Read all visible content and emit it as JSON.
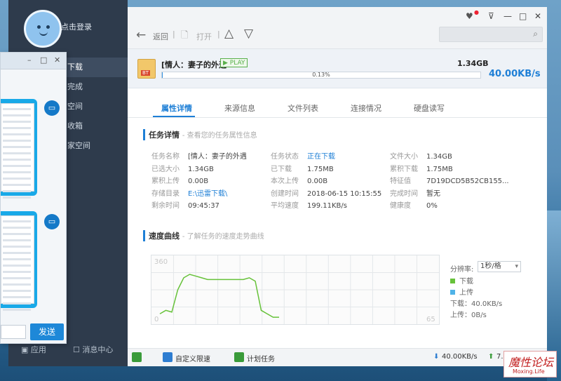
{
  "sidebar": {
    "login": "点击登录",
    "items": [
      "下载",
      "完成",
      "空间",
      "收箱",
      "家空间"
    ],
    "bottom_app": "应用",
    "bottom_msg": "消息中心"
  },
  "chat": {
    "send": "发送"
  },
  "toolbar": {
    "back": "返回",
    "open": "打开"
  },
  "task": {
    "name": "[情人：妻子的外遇",
    "play": "PLAY",
    "size": "1.34GB",
    "progress_pct": "0.13%",
    "progress_value": 0.0013,
    "speed": "40.00KB/s",
    "file_badge": "BT"
  },
  "tabs": [
    "属性详情",
    "来源信息",
    "文件列表",
    "连接情况",
    "硬盘读写"
  ],
  "details": {
    "title": "任务详情",
    "hint": "- 查看您的任务属性信息",
    "col1": [
      [
        "任务名称",
        "[情人：妻子的外遇"
      ],
      [
        "已选大小",
        "1.34GB"
      ],
      [
        "累积上传",
        "0.00B"
      ],
      [
        "存储目录",
        "E:\\迅雷下载\\"
      ],
      [
        "剩余时间",
        "09:45:37"
      ]
    ],
    "col2": [
      [
        "任务状态",
        "正在下载"
      ],
      [
        "已下载",
        "1.75MB"
      ],
      [
        "本次上传",
        "0.00B"
      ],
      [
        "创建时间",
        "2018-06-15 10:15:55"
      ],
      [
        "平均速度",
        "199.11KB/s"
      ]
    ],
    "col3": [
      [
        "文件大小",
        "1.34GB"
      ],
      [
        "累积下载",
        "1.75MB"
      ],
      [
        "特征值",
        "7D19DCD5B52CB155..."
      ],
      [
        "完成时间",
        "暂无"
      ],
      [
        "健康度",
        "0%"
      ]
    ]
  },
  "speed": {
    "title": "速度曲线",
    "hint": "- 了解任务的速度走势曲线",
    "ymax": "360",
    "ymin": "0",
    "xmax": "65",
    "rate_label": "分辨率:",
    "rate_value": "1秒/格",
    "dl_label": "下载",
    "ul_label": "上传",
    "dl_speed": "下载：40.0KB/s",
    "ul_speed": "上传：0B/s"
  },
  "chart_data": {
    "type": "line",
    "series": [
      {
        "name": "下载",
        "values": [
          40,
          60,
          50,
          180,
          250,
          270,
          260,
          250,
          240,
          240,
          240,
          240,
          240,
          240,
          240,
          250,
          230,
          60,
          40,
          20,
          20
        ]
      }
    ],
    "ylim": [
      0,
      360
    ],
    "colors": {
      "download": "#67c23a",
      "upload": "#4fb3e8"
    }
  },
  "status": {
    "limit": "自定义限速",
    "plan": "计划任务",
    "down": "40.00KB/s",
    "up": "7.03KB/s"
  },
  "watermark": {
    "t1": "魔性论坛",
    "t2": "Moxing.Life"
  }
}
